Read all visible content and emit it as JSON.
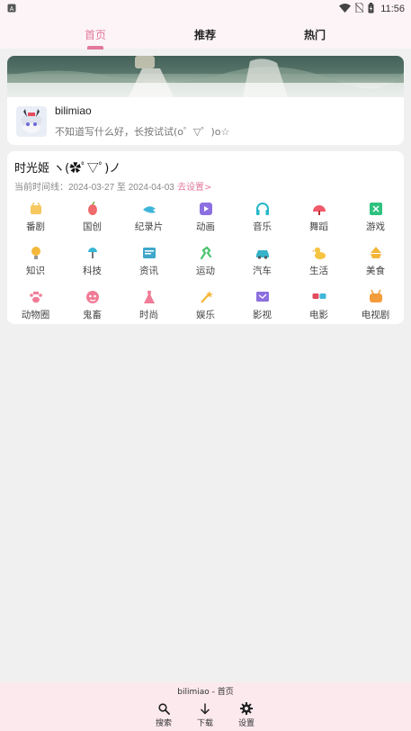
{
  "status_bar": {
    "time": "11:56",
    "left_icon": "app-notification-icon",
    "icons": [
      "wifi-icon",
      "no-sim-icon",
      "battery-charging-icon"
    ]
  },
  "tabs": [
    {
      "label": "首页",
      "active": true
    },
    {
      "label": "推荐",
      "active": false
    },
    {
      "label": "热门",
      "active": false
    }
  ],
  "profile": {
    "name": "bilimiao",
    "subtitle": "不知道写什么好，长按试试(o゜▽゜)o☆"
  },
  "time_card": {
    "title": "时光姬 ヽ(✿ﾟ▽ﾟ)ノ",
    "range_label": "当前时间线：",
    "range_value": "2024-03-27 至 2024-04-03",
    "goto_settings": "去设置>"
  },
  "categories": [
    {
      "label": "番剧",
      "icon": "anime-icon",
      "color": "#f6c85f"
    },
    {
      "label": "国创",
      "icon": "guochuang-icon",
      "color": "#ef6a6a"
    },
    {
      "label": "纪录片",
      "icon": "documentary-icon",
      "color": "#3fb6d9"
    },
    {
      "label": "动画",
      "icon": "animation-play-icon",
      "color": "#8c6fe0"
    },
    {
      "label": "音乐",
      "icon": "headphones-icon",
      "color": "#26b8c8"
    },
    {
      "label": "舞蹈",
      "icon": "fan-dance-icon",
      "color": "#f05a6c"
    },
    {
      "label": "游戏",
      "icon": "game-icon",
      "color": "#2ec27e"
    },
    {
      "label": "知识",
      "icon": "lightbulb-icon",
      "color": "#f4b73b"
    },
    {
      "label": "科技",
      "icon": "tech-icon",
      "color": "#36b7d6"
    },
    {
      "label": "资讯",
      "icon": "news-icon",
      "color": "#3fa7c9"
    },
    {
      "label": "运动",
      "icon": "sports-icon",
      "color": "#49c46d"
    },
    {
      "label": "汽车",
      "icon": "car-icon",
      "color": "#36b3c8"
    },
    {
      "label": "生活",
      "icon": "duck-icon",
      "color": "#f5c542"
    },
    {
      "label": "美食",
      "icon": "food-icon",
      "color": "#f3b53a"
    },
    {
      "label": "动物圈",
      "icon": "paw-icon",
      "color": "#f07c97"
    },
    {
      "label": "鬼畜",
      "icon": "kichiku-icon",
      "color": "#f07c97"
    },
    {
      "label": "时尚",
      "icon": "dress-icon",
      "color": "#f07c97"
    },
    {
      "label": "娱乐",
      "icon": "magic-wand-icon",
      "color": "#f4b73b"
    },
    {
      "label": "影视",
      "icon": "tv-icon",
      "color": "#8c6fe0"
    },
    {
      "label": "电影",
      "icon": "3d-glasses-icon",
      "color": "#3fb6d9"
    },
    {
      "label": "电视剧",
      "icon": "tv-drama-icon",
      "color": "#f39c3b"
    }
  ],
  "bottom": {
    "title": "bilimiao - 首页",
    "buttons": [
      {
        "label": "搜索",
        "icon": "search-icon"
      },
      {
        "label": "下载",
        "icon": "download-icon"
      },
      {
        "label": "设置",
        "icon": "gear-icon"
      }
    ]
  },
  "colors": {
    "accent": "#e2789c",
    "header_bg": "#fdf4f7",
    "bottom_bg": "#fbe9ee",
    "page_bg": "#f0f0f0"
  }
}
